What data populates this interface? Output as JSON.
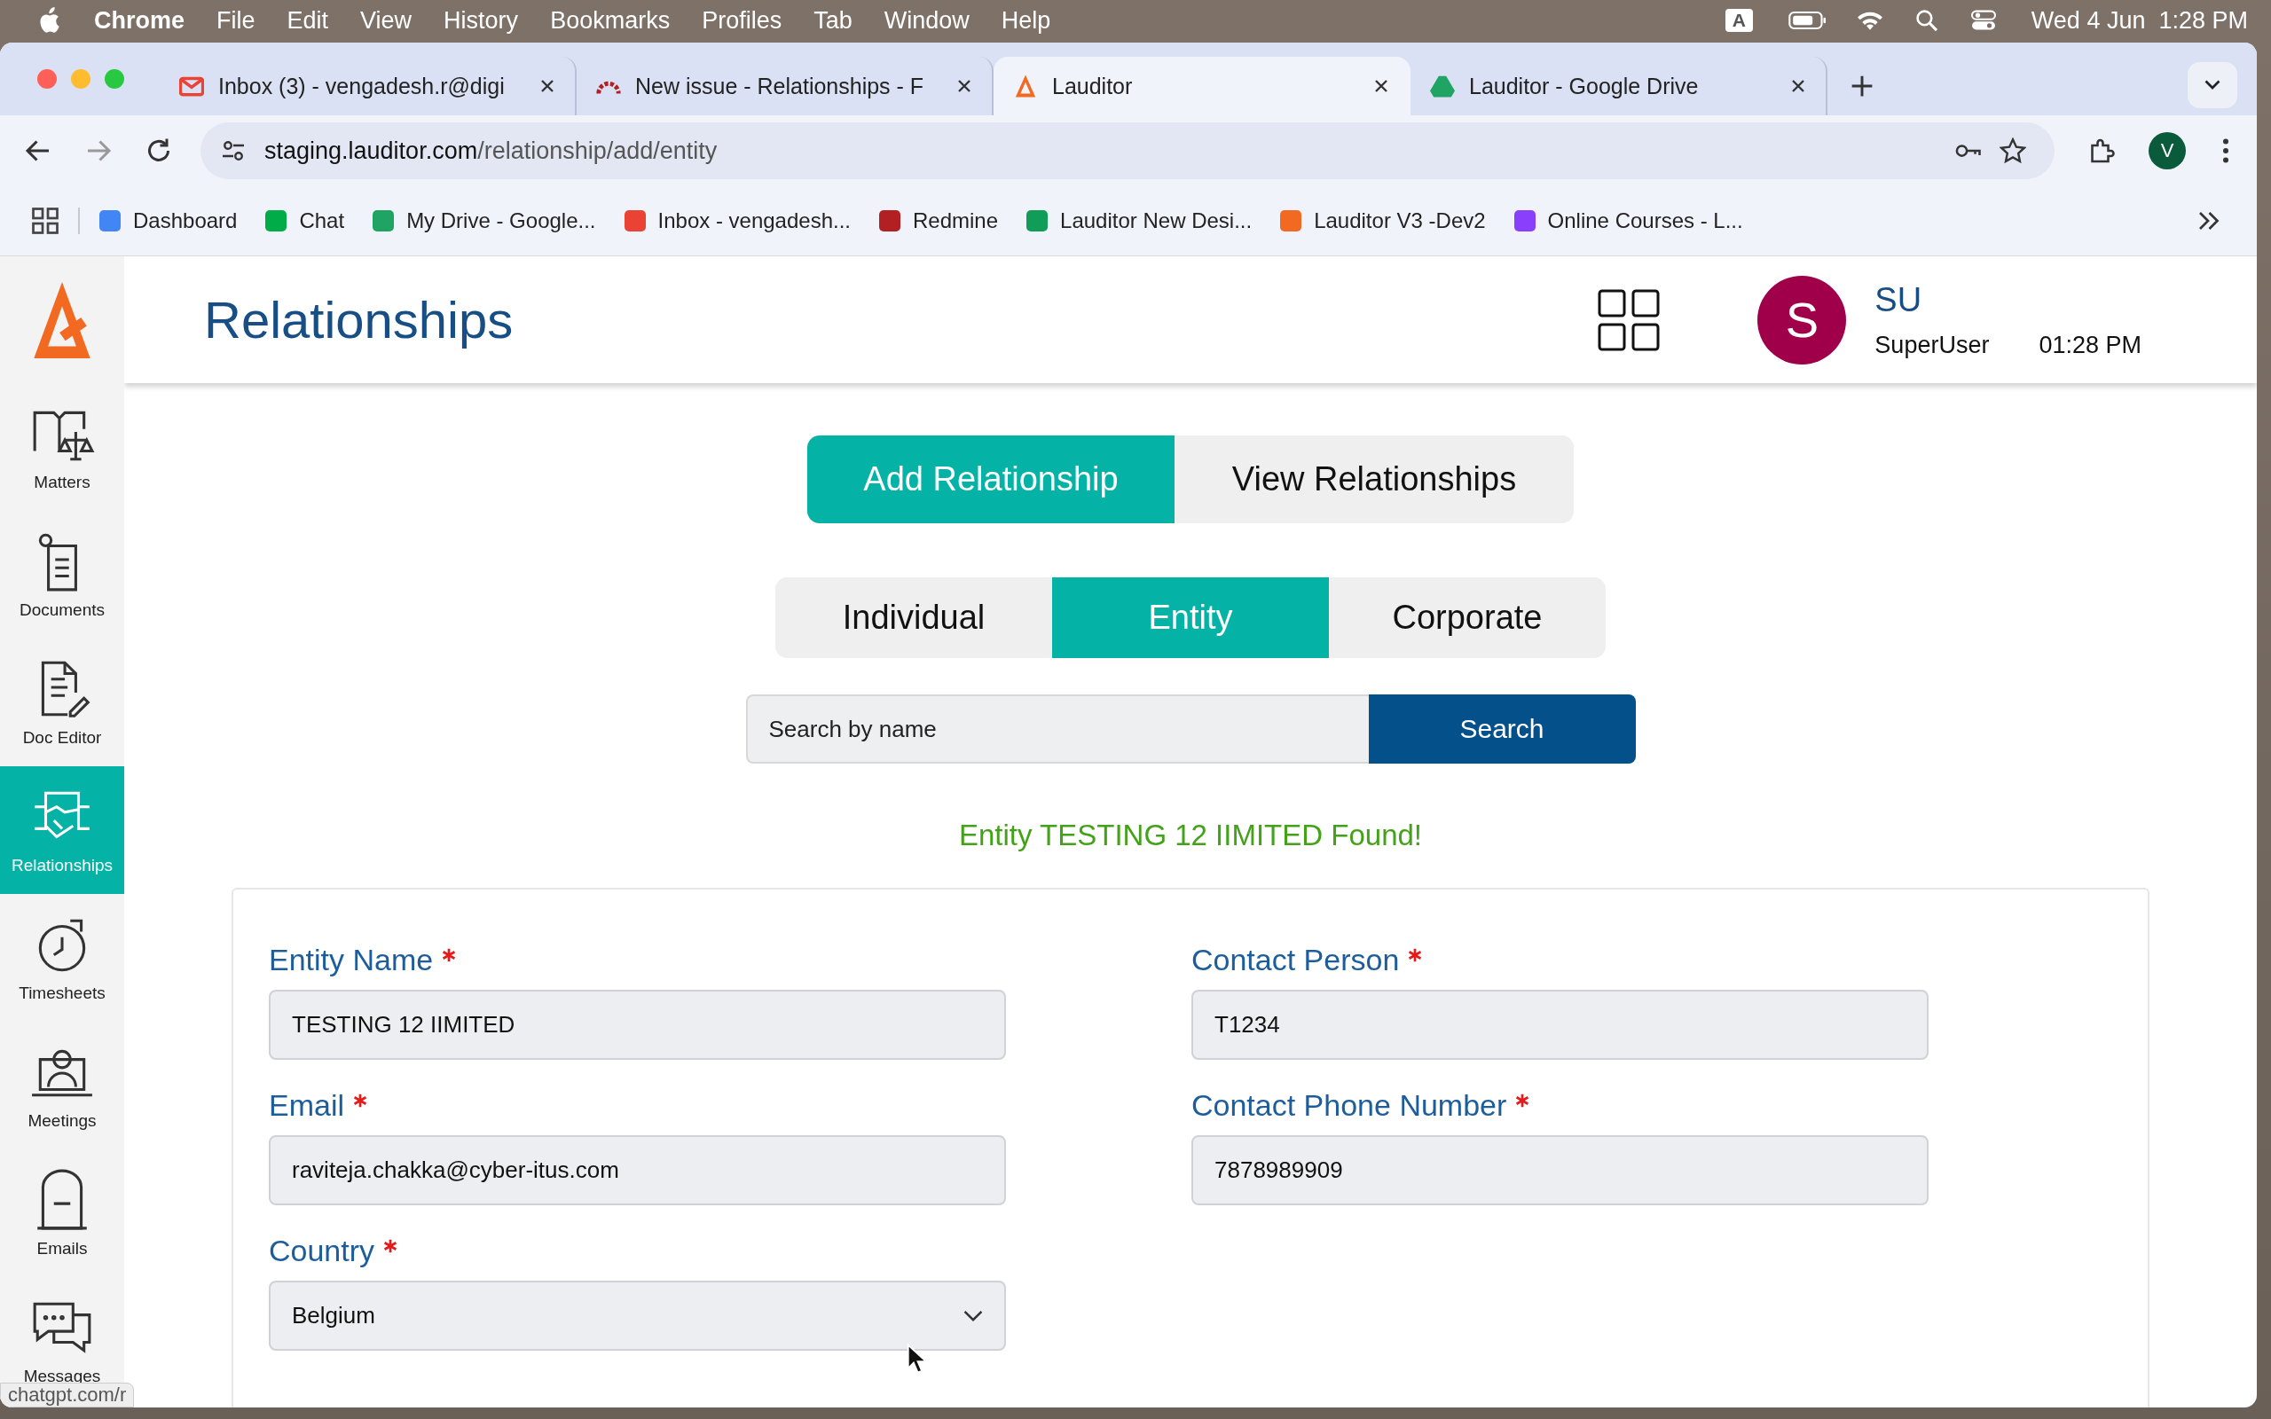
{
  "menu_bar": {
    "app": "Chrome",
    "menus": [
      "File",
      "Edit",
      "View",
      "History",
      "Bookmarks",
      "Profiles",
      "Tab",
      "Window",
      "Help"
    ],
    "input_source": "A",
    "clock": "Wed 4 Jun  1:28 PM"
  },
  "browser": {
    "tabs": [
      {
        "title": "Inbox (3) - vengadesh.r@digi",
        "kind": "gmail",
        "selected": false
      },
      {
        "title": "New issue - Relationships - F",
        "kind": "redmine",
        "selected": false
      },
      {
        "title": "Lauditor",
        "kind": "lauditor",
        "selected": true
      },
      {
        "title": "Lauditor - Google Drive",
        "kind": "drive",
        "selected": false
      }
    ],
    "url_host": "staging.lauditor.com",
    "url_path": "/relationship/add/entity",
    "profile": "V",
    "bookmarks": [
      {
        "label": "Dashboard",
        "kind": "google"
      },
      {
        "label": "Chat",
        "kind": "chat"
      },
      {
        "label": "My Drive - Google...",
        "kind": "drive"
      },
      {
        "label": "Inbox - vengadesh...",
        "kind": "gmail"
      },
      {
        "label": "Redmine",
        "kind": "redmine"
      },
      {
        "label": "Lauditor New Desi...",
        "kind": "sheets"
      },
      {
        "label": "Lauditor V3 -Dev2",
        "kind": "lauditor"
      },
      {
        "label": "Online Courses - L...",
        "kind": "course"
      }
    ],
    "status_url": "chatgpt.com/r"
  },
  "sidebar": {
    "items": [
      {
        "label": "Matters",
        "kind": "matters",
        "selected": false
      },
      {
        "label": "Documents",
        "kind": "documents",
        "selected": false
      },
      {
        "label": "Doc Editor",
        "kind": "editor",
        "selected": false
      },
      {
        "label": "Relationships",
        "kind": "relationships",
        "selected": true
      },
      {
        "label": "Timesheets",
        "kind": "timesheets",
        "selected": false
      },
      {
        "label": "Meetings",
        "kind": "meetings",
        "selected": false
      },
      {
        "label": "Emails",
        "kind": "emails",
        "selected": false
      },
      {
        "label": "Messages",
        "kind": "messages",
        "selected": false
      }
    ]
  },
  "header": {
    "title": "Relationships",
    "user": {
      "initial": "S",
      "short": "SU",
      "name": "SuperUser",
      "time": "01:28 PM"
    }
  },
  "mode_tabs": [
    {
      "label": "Add Relationship",
      "selected": true
    },
    {
      "label": "View Relationships",
      "selected": false
    }
  ],
  "type_tabs": [
    {
      "label": "Individual",
      "selected": false
    },
    {
      "label": "Entity",
      "selected": true
    },
    {
      "label": "Corporate",
      "selected": false
    }
  ],
  "search": {
    "placeholder": "Search by name",
    "button": "Search"
  },
  "message": "Entity TESTING 12 IIMITED Found!",
  "form": {
    "fields": [
      {
        "label": "Entity Name",
        "required": true,
        "kind": "text",
        "value": "TESTING 12 IIMITED"
      },
      {
        "label": "Contact Person",
        "required": true,
        "kind": "text",
        "value": "T1234"
      },
      {
        "label": "Email",
        "required": true,
        "kind": "text",
        "value": "raviteja.chakka@cyber-itus.com"
      },
      {
        "label": "Contact Phone Number",
        "required": true,
        "kind": "text",
        "value": "7878989909"
      },
      {
        "label": "Country",
        "required": true,
        "kind": "select",
        "value": "Belgium"
      }
    ]
  }
}
